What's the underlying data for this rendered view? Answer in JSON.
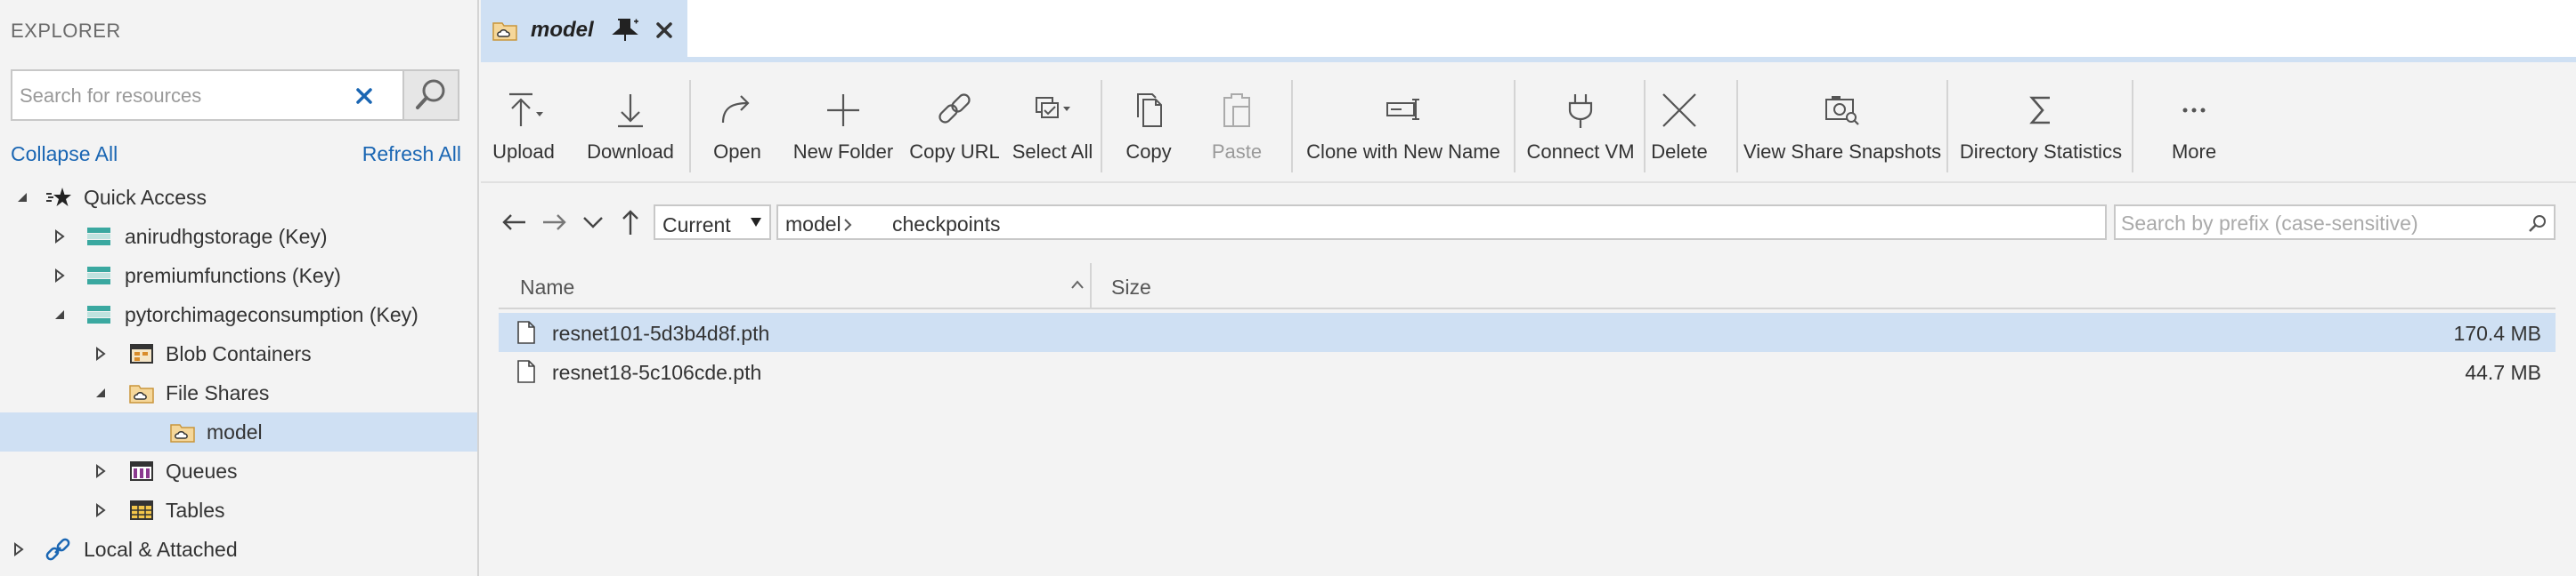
{
  "sidebar": {
    "title": "EXPLORER",
    "search_placeholder": "Search for resources",
    "collapse_all": "Collapse All",
    "refresh_all": "Refresh All",
    "tree": [
      {
        "label": "Quick Access",
        "icon": "quick-access-icon",
        "expanded": true
      },
      {
        "label": "anirudhgstorage (Key)",
        "icon": "storage-account-icon",
        "expanded": false
      },
      {
        "label": "premiumfunctions (Key)",
        "icon": "storage-account-icon",
        "expanded": false
      },
      {
        "label": "pytorchimageconsumption (Key)",
        "icon": "storage-account-icon",
        "expanded": true
      },
      {
        "label": "Blob Containers",
        "icon": "blob-containers-icon",
        "expanded": false
      },
      {
        "label": "File Shares",
        "icon": "file-shares-icon",
        "expanded": true
      },
      {
        "label": "model",
        "icon": "file-share-icon",
        "selected": true
      },
      {
        "label": "Queues",
        "icon": "queues-icon",
        "expanded": false
      },
      {
        "label": "Tables",
        "icon": "tables-icon",
        "expanded": false
      },
      {
        "label": "Local & Attached",
        "icon": "link-icon",
        "expanded": false
      }
    ]
  },
  "tab": {
    "label": "model"
  },
  "toolbar": {
    "upload": "Upload",
    "download": "Download",
    "open": "Open",
    "new_folder": "New Folder",
    "copy_url": "Copy URL",
    "select_all": "Select All",
    "copy": "Copy",
    "paste": "Paste",
    "clone": "Clone with New Name",
    "connect_vm": "Connect VM",
    "delete": "Delete",
    "snapshots": "View Share Snapshots",
    "dir_stats": "Directory Statistics",
    "more": "More"
  },
  "navbar": {
    "view_mode": "Current",
    "path": [
      "model",
      "checkpoints"
    ],
    "prefix_placeholder": "Search by prefix (case-sensitive)"
  },
  "grid": {
    "columns": {
      "name": "Name",
      "size": "Size"
    },
    "rows": [
      {
        "name": "resnet101-5d3b4d8f.pth",
        "size": "170.4 MB",
        "selected": true
      },
      {
        "name": "resnet18-5c106cde.pth",
        "size": "44.7 MB",
        "selected": false
      }
    ]
  },
  "colors": {
    "accent": "#1a66b3",
    "selection": "#cfe0f3",
    "background": "#f3f3f3"
  }
}
